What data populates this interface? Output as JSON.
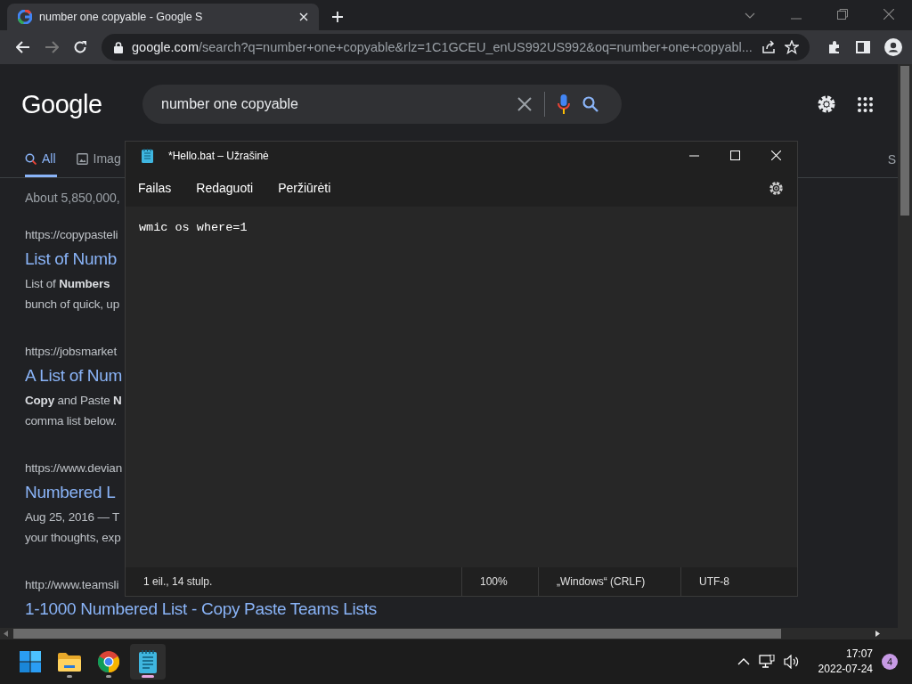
{
  "browser": {
    "tab_title": "number one copyable - Google S",
    "url_domain": "google.com",
    "url_path": "/search?q=number+one+copyable&rlz=1C1GCEU_enUS992US992&oq=number+one+copyabl..."
  },
  "google": {
    "logo": "Google",
    "query": "number one copyable",
    "tabs": [
      {
        "label": "All",
        "selected": true,
        "kind": "all"
      },
      {
        "label": "Imag",
        "selected": false,
        "kind": "images"
      }
    ],
    "right_tab": "S",
    "result_stats": "About 5,850,000,",
    "results": [
      {
        "url": "https://copypasteli",
        "title": "List of Numb",
        "snippet": [
          "List of **Numbers**",
          "bunch of quick, up"
        ]
      },
      {
        "url": "https://jobsmarket",
        "title": "A List of Num",
        "snippet": [
          "**Copy** and Paste **N**",
          "comma list below."
        ]
      },
      {
        "url": "https://www.devian",
        "title": "Numbered L",
        "snippet": [
          "Aug 25, 2016 — T",
          "your thoughts, exp"
        ]
      },
      {
        "url": "http://www.teamsli",
        "title": "1-1000 Numbered List - Copy Paste Teams Lists"
      }
    ]
  },
  "notepad": {
    "title": "*Hello.bat – Užrašinė",
    "menus": [
      "Failas",
      "Redaguoti",
      "Peržiūrėti"
    ],
    "text": "wmic os where=1",
    "status": [
      "1 eil., 14 stulp.",
      "100%",
      "„Windows“ (CRLF)",
      "UTF-8"
    ]
  },
  "taskbar": {
    "apps": [
      {
        "kind": "start",
        "selected": false
      },
      {
        "kind": "explorer",
        "selected": false
      },
      {
        "kind": "chrome",
        "selected": false
      },
      {
        "kind": "notepad",
        "selected": true
      }
    ],
    "time": "17:07",
    "date": "2022-07-24",
    "notifications": "4"
  }
}
